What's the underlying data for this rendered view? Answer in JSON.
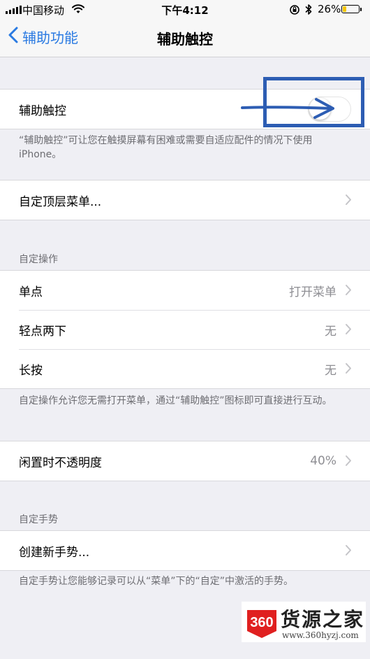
{
  "status": {
    "carrier": "中国移动",
    "time": "下午4:12",
    "battery_percent": "26%",
    "battery_level": 0.26,
    "icons": [
      "signal-icon",
      "wifi-icon",
      "orientation-lock-icon",
      "bluetooth-icon",
      "battery-icon"
    ]
  },
  "nav": {
    "back_label": "辅助功能",
    "title": "辅助触控"
  },
  "main_toggle": {
    "label": "辅助触控",
    "on": false,
    "description": "“辅助触控”可让您在触摸屏幕有困难或需要自适应配件的情况下使用 iPhone。"
  },
  "top_menu": {
    "label": "自定顶层菜单..."
  },
  "custom_actions": {
    "header": "自定操作",
    "items": [
      {
        "label": "单点",
        "value": "打开菜单"
      },
      {
        "label": "轻点两下",
        "value": "无"
      },
      {
        "label": "长按",
        "value": "无"
      }
    ],
    "footer": "自定操作允许您无需打开菜单，通过“辅助触控”图标即可直接进行互动。"
  },
  "idle_opacity": {
    "label": "闲置时不透明度",
    "value": "40%"
  },
  "custom_gestures": {
    "header": "自定手势",
    "create_label": "创建新手势...",
    "footer": "自定手势让您能够记录可以从“菜单”下的“自定”中激活的手势。"
  },
  "watermark": {
    "logo_text": "360",
    "brand": "货源之家",
    "url": "www.360hyzj.com"
  },
  "colors": {
    "accent": "#2a7ae2",
    "background": "#efeff4",
    "secondary_text": "#8e8e93",
    "annotation": "#2d5db3",
    "watermark_red": "#e02020"
  }
}
